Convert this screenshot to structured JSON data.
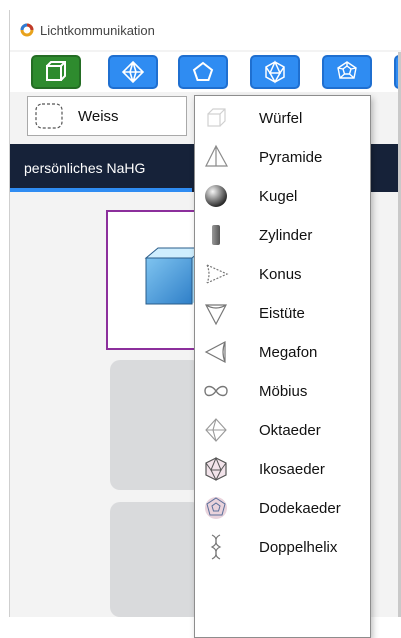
{
  "window": {
    "title": "Lichtkommunikation",
    "logo_icon": "ring-logo-icon"
  },
  "toolbar": {
    "buttons": [
      {
        "icon": "cube-icon",
        "color": "#2e8b2e",
        "selected": true
      },
      {
        "icon": "octahedron-icon",
        "color": "#2f8cf2"
      },
      {
        "icon": "pentagon-icon",
        "color": "#2f8cf2"
      },
      {
        "icon": "icosahedron-icon",
        "color": "#2f8cf2"
      },
      {
        "icon": "dodecahedron-icon",
        "color": "#2f8cf2"
      }
    ]
  },
  "color_select": {
    "value": "Weiss",
    "swatch_icon": "dashed-swatch-icon"
  },
  "tabs": [
    {
      "label": "persönliches NaHG",
      "active": true
    }
  ],
  "shape_menu": {
    "items": [
      {
        "label": "Würfel",
        "icon": "cube-outline-icon"
      },
      {
        "label": "Pyramide",
        "icon": "pyramid-icon"
      },
      {
        "label": "Kugel",
        "icon": "sphere-icon"
      },
      {
        "label": "Zylinder",
        "icon": "cylinder-icon"
      },
      {
        "label": "Konus",
        "icon": "cone-icon"
      },
      {
        "label": "Eistüte",
        "icon": "ice-cream-cone-icon"
      },
      {
        "label": "Megafon",
        "icon": "megaphone-icon"
      },
      {
        "label": "Möbius",
        "icon": "moebius-icon"
      },
      {
        "label": "Oktaeder",
        "icon": "octahedron-icon"
      },
      {
        "label": "Ikosaeder",
        "icon": "icosahedron-icon"
      },
      {
        "label": "Dodekaeder",
        "icon": "dodecahedron-icon"
      },
      {
        "label": "Doppelhelix",
        "icon": "double-helix-icon"
      }
    ]
  },
  "colors": {
    "tab_bar": "#162239",
    "accent": "#2f8cf2",
    "selected_border": "#8c2f9c",
    "active_tool": "#2e8b2e"
  }
}
